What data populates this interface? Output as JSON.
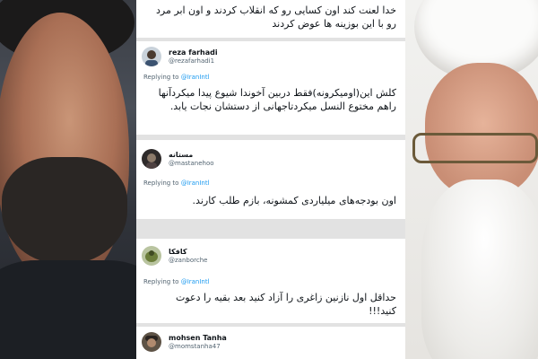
{
  "tweets": [
    {
      "text_lines": [
        "خدا لعنت کند اون کسایی رو که انقلاب کردند و اون ابر مرد",
        "رو با این بوزینه ها عوض کردند"
      ]
    },
    {
      "name": "reza farhadi",
      "handle": "@rezafarhadi1",
      "replying_prefix": "Replying to ",
      "replying_to": "@IranIntl",
      "text_lines": [
        "کلش این(اومیکرونه)فقط دربین آخوندا شیوع پیدا میکردآنها",
        "راهم مختوع النسل میکردتاجهانی از دستشان نجات یابد."
      ]
    },
    {
      "name": "مستانه",
      "handle": "@mastanehoo",
      "replying_prefix": "Replying to ",
      "replying_to": "@IranIntl",
      "text_lines": [
        "اون بودجه‌های میلیاردی کمشونه، بازم طلب کارند."
      ]
    },
    {
      "name": "کافکا",
      "handle": "@zanborche",
      "replying_prefix": "Replying to ",
      "replying_to": "@IranIntl",
      "text_lines": [
        "حداقل اول نازنین زاغری را آزاد کنید بعد بقیه را دعوت کنید!!!"
      ]
    },
    {
      "name": "mohsen Tanha",
      "handle": "@momstanha47"
    }
  ],
  "colors": {
    "link": "#1d9bf0",
    "text": "#0f1419",
    "secondary": "#536471"
  }
}
